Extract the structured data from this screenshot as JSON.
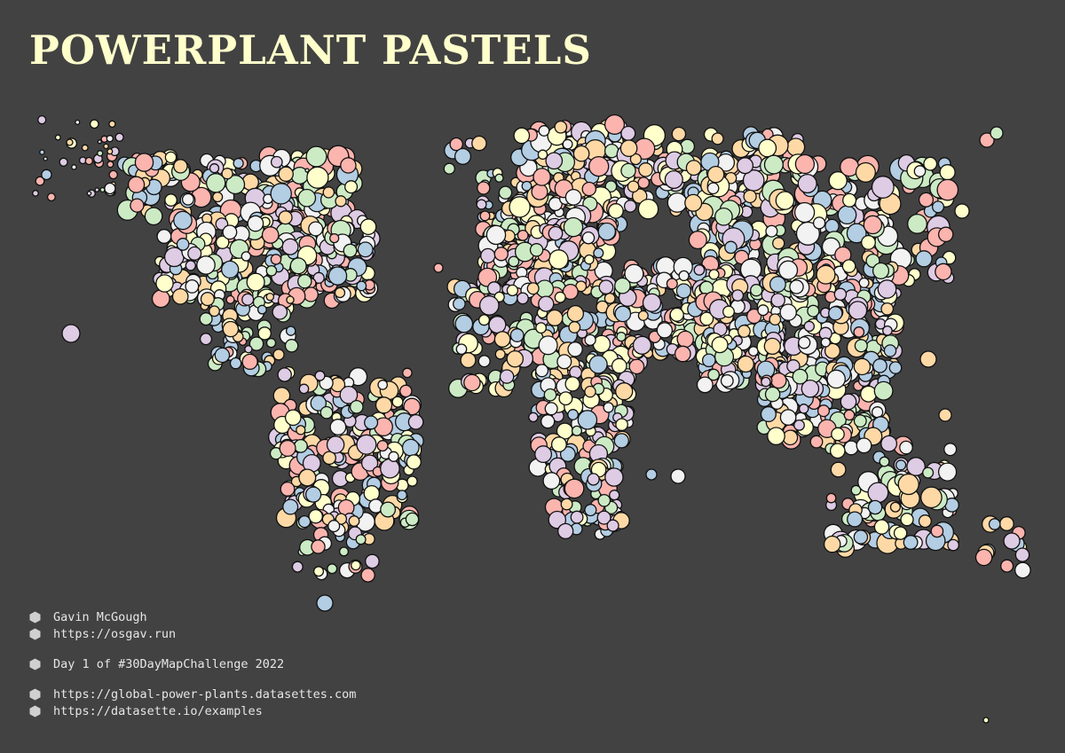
{
  "title": "POWERPLANT PASTELS",
  "colors": {
    "background": "#424242",
    "title": "#ffffcc",
    "credit_text": "#e6e6e6",
    "marker_outline": "#111111",
    "pastel_palette": [
      "#b3cde3",
      "#decbe4",
      "#fed9a6",
      "#ffffcc",
      "#fbb4ae",
      "#ccebc5",
      "#f2f2f2"
    ]
  },
  "legend_icon": "hexagon-icon",
  "credits": [
    {
      "text": "Gavin McGough",
      "group": 1
    },
    {
      "text": "https://osgav.run",
      "group": 1
    },
    {
      "text": "Day 1 of #30DayMapChallenge 2022",
      "group": 2
    },
    {
      "text": "https://global-power-plants.datasettes.com",
      "group": 3
    },
    {
      "text": "https://datasette.io/examples",
      "group": 3
    }
  ]
}
